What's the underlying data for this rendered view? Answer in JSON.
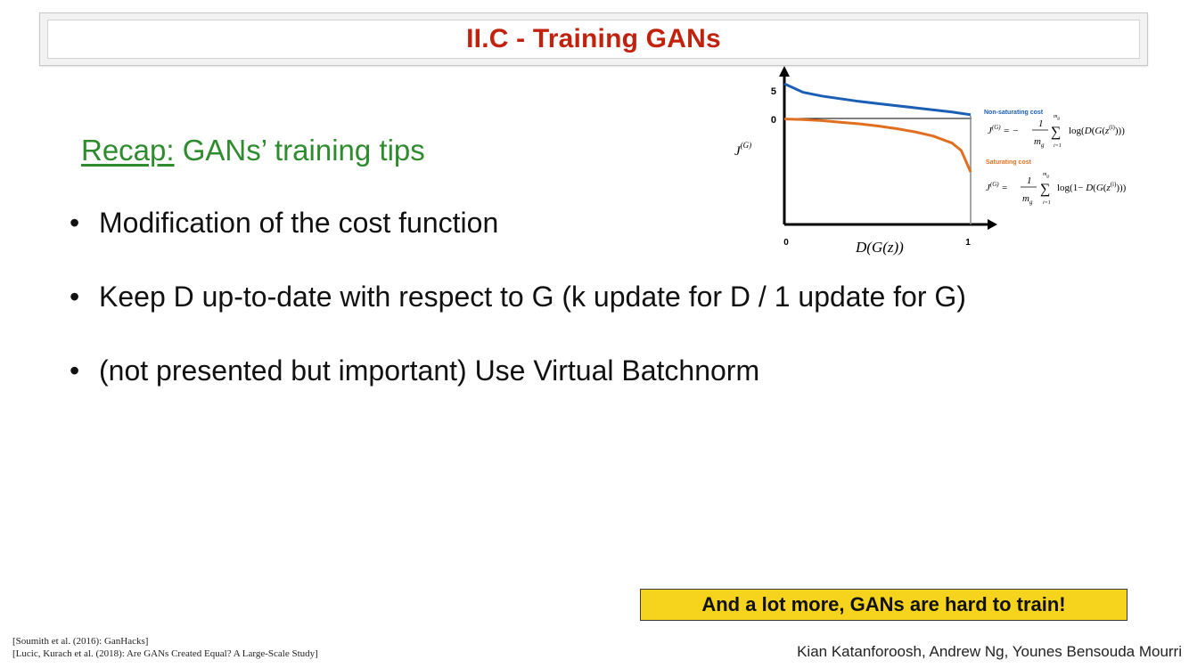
{
  "title": "II.C - Training GANs",
  "recap": {
    "label": "Recap:",
    "text": " GANs’ training tips"
  },
  "bullets": [
    {
      "symbol": "•",
      "text": "Modification of the cost function"
    },
    {
      "symbol": "•",
      "text": "Keep D up-to-date with respect to G (k update for D / 1 update for G)"
    },
    {
      "symbol": "•",
      "text": "(not presented but important) Use Virtual Batchnorm"
    }
  ],
  "callout": "And a lot more, GANs are hard to train!",
  "references": [
    "[Soumith et al. (2016): GanHacks]",
    "[Lucic, Kurach et al. (2018): Are GANs Created Equal? A Large-Scale Study]"
  ],
  "authors": "Kian Katanforoosh, Andrew Ng, Younes Bensouda Mourri",
  "colors": {
    "title": "#c0220e",
    "recap": "#2e8b2e",
    "non_saturating": "#1a5fb4",
    "saturating": "#e07020",
    "callout_bg": "#f6d31c"
  },
  "chart_data": {
    "type": "line",
    "x_tick_labels": [
      "0",
      "1"
    ],
    "y_tick_labels": [
      "5",
      "0"
    ],
    "xlabel": "D(G(z))",
    "ylabel": "J(G)",
    "xlim": [
      0,
      1
    ],
    "series": [
      {
        "name": "Non-saturating cost",
        "formula": "J(G) = −(1/m_g) Σ_{i=1}^{m_g} log(D(G(z(i))))",
        "x": [
          0.0,
          0.1,
          0.2,
          0.3,
          0.4,
          0.5,
          0.6,
          0.7,
          0.8,
          0.9,
          1.0
        ],
        "y": [
          6.5,
          4.9,
          4.2,
          3.7,
          3.2,
          2.8,
          2.4,
          2.0,
          1.6,
          1.2,
          0.7
        ]
      },
      {
        "name": "Saturating cost",
        "formula": "J(G) = (1/m_g) Σ_{i=1}^{m_g} log(1 − D(G(z(i))))",
        "x": [
          0.0,
          0.1,
          0.2,
          0.3,
          0.4,
          0.5,
          0.6,
          0.7,
          0.8,
          0.9,
          0.95,
          1.0
        ],
        "y": [
          -0.1,
          -0.2,
          -0.4,
          -0.7,
          -1.0,
          -1.4,
          -1.9,
          -2.5,
          -3.3,
          -4.6,
          -6.0,
          -10.0
        ]
      }
    ]
  }
}
